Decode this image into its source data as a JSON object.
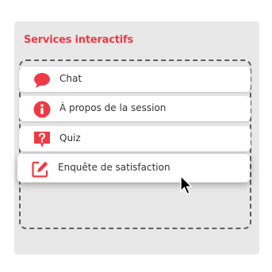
{
  "panel": {
    "title": "Services interactifs",
    "accent_color": "#ee3a43"
  },
  "items": [
    {
      "label": "Chat",
      "icon": "chat-bubble-icon"
    },
    {
      "label": "À propos de la session",
      "icon": "info-icon"
    },
    {
      "label": "Quiz",
      "icon": "quiz-icon"
    },
    {
      "label": "Enquête de satisfaction",
      "icon": "edit-icon"
    }
  ],
  "cursor": {
    "icon": "mouse-pointer-icon"
  }
}
